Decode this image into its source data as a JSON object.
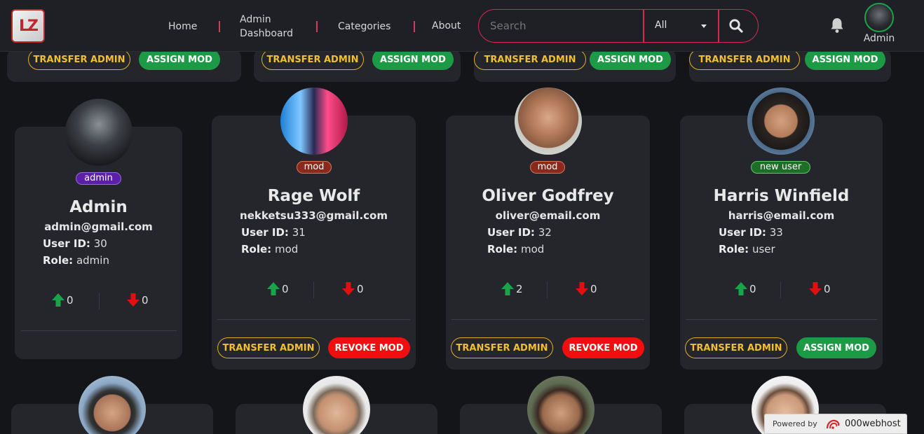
{
  "brand": {
    "logo_text": "LZ"
  },
  "nav": {
    "home": "Home",
    "dashboard_line1": "Admin",
    "dashboard_line2": "Dashboard",
    "categories": "Categories",
    "about": "About"
  },
  "search": {
    "placeholder": "Search",
    "filter_value": "All"
  },
  "user": {
    "label": "Admin"
  },
  "top_cards": {
    "transfer_label": "TRANSFER ADMIN",
    "assign_label": "ASSIGN MOD"
  },
  "cards": [
    {
      "role_badge": "admin",
      "name": "Admin",
      "email": "admin@gmail.com",
      "user_id_label": "User ID:",
      "user_id": "30",
      "role_label": "Role:",
      "role": "admin",
      "upvotes": "0",
      "downvotes": "0"
    },
    {
      "role_badge": "mod",
      "name": "Rage Wolf",
      "email": "nekketsu333@gmail.com",
      "user_id_label": "User ID:",
      "user_id": "31",
      "role_label": "Role:",
      "role": "mod",
      "upvotes": "0",
      "downvotes": "0",
      "transfer_label": "TRANSFER ADMIN",
      "action_label": "REVOKE MOD"
    },
    {
      "role_badge": "mod",
      "name": "Oliver Godfrey",
      "email": "oliver@email.com",
      "user_id_label": "User ID:",
      "user_id": "32",
      "role_label": "Role:",
      "role": "mod",
      "upvotes": "2",
      "downvotes": "0",
      "transfer_label": "TRANSFER ADMIN",
      "action_label": "REVOKE MOD"
    },
    {
      "role_badge": "new user",
      "name": "Harris Winfield",
      "email": "harris@email.com",
      "user_id_label": "User ID:",
      "user_id": "33",
      "role_label": "Role:",
      "role": "user",
      "upvotes": "0",
      "downvotes": "0",
      "transfer_label": "TRANSFER ADMIN",
      "action_label": "ASSIGN MOD"
    }
  ],
  "footer_badge": {
    "powered_by": "Powered by",
    "host": "000webhost"
  },
  "colors": {
    "accent": "#d7294f",
    "transfer": "#f1bf2f",
    "assign": "#1c9a45",
    "revoke": "#f20e0e",
    "upvote": "#1aa34a",
    "downvote": "#e01010"
  }
}
